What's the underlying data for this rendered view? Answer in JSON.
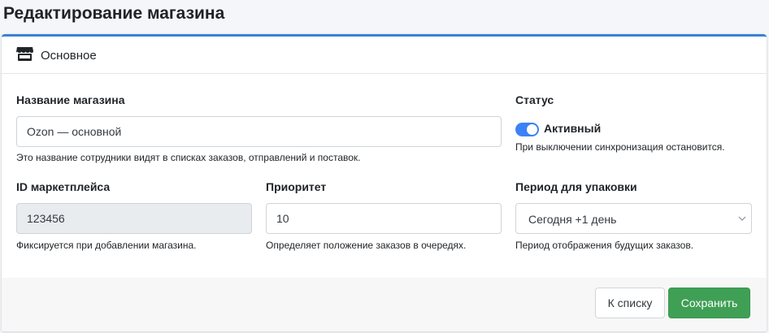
{
  "page": {
    "title": "Редактирование магазина"
  },
  "card": {
    "header_title": "Основное",
    "accent_color": "#3b82d4"
  },
  "form": {
    "name": {
      "label": "Название магазина",
      "value": "Ozon — основной",
      "help": "Это название сотрудники видят в списках заказов, отправлений и поставок."
    },
    "status": {
      "label": "Статус",
      "toggle_label": "Активный",
      "enabled": true,
      "help": "При выключении синхронизация остановится."
    },
    "marketplace_id": {
      "label": "ID маркетплейса",
      "value": "123456",
      "disabled": true,
      "help": "Фиксируется при добавлении магазина."
    },
    "priority": {
      "label": "Приоритет",
      "value": "10",
      "help": "Определяет положение заказов в очередях."
    },
    "packing_period": {
      "label": "Период для упаковки",
      "selected": "Сегодня +1 день",
      "help": "Период отображения будущих заказов."
    }
  },
  "footer": {
    "back_label": "К списку",
    "save_label": "Сохранить",
    "save_color": "#3fa055"
  },
  "icons": {
    "header": "store-icon",
    "select": "chevron-down-icon"
  }
}
